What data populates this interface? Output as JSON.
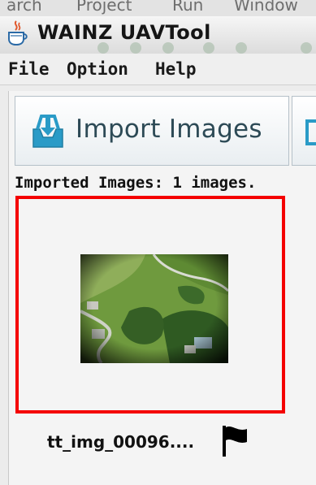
{
  "window": {
    "title": "WAINZ UAVTool"
  },
  "background_menu": {
    "items": [
      "arch",
      "Project",
      "Run",
      "Window"
    ]
  },
  "menubar": {
    "items": [
      {
        "label": "File"
      },
      {
        "label": "Option"
      },
      {
        "label": "Help"
      }
    ]
  },
  "toolbar": {
    "import_label": "Import Images"
  },
  "status": {
    "imported_text": "Imported Images: 1 images."
  },
  "thumbnail": {
    "name": "tt_img_00096...."
  },
  "colors": {
    "selection_border": "#f40000",
    "button_text": "#2d4a56",
    "import_icon": "#2a9bc7"
  },
  "icons": {
    "app": "java-cup-icon",
    "import": "import-tray-icon",
    "flag": "flag-icon"
  }
}
